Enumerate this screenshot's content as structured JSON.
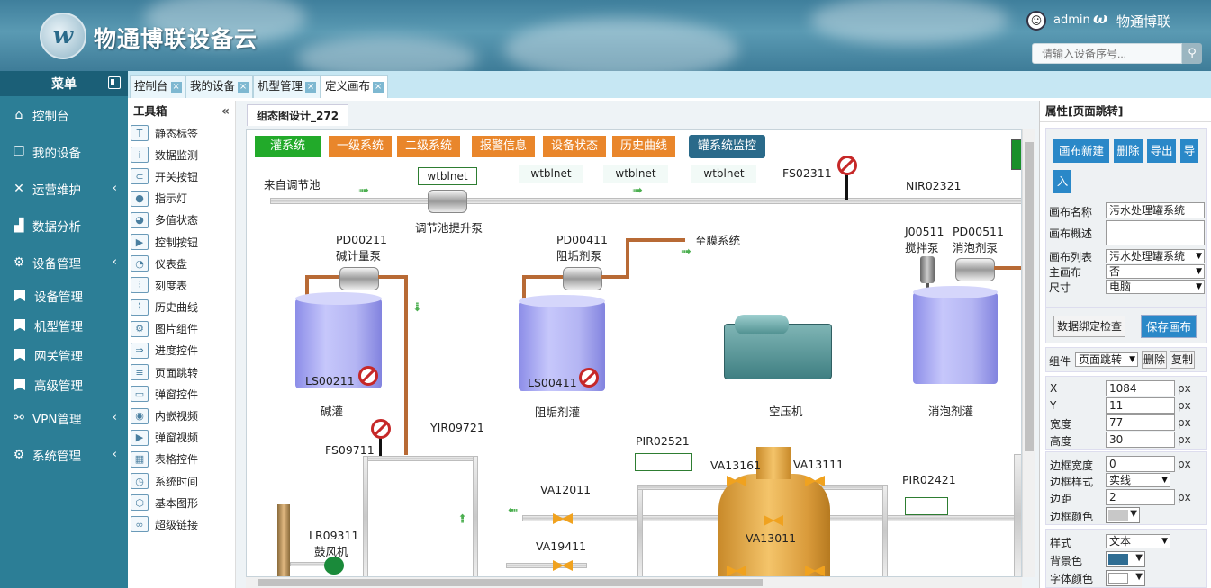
{
  "header": {
    "logo_mark": "w",
    "logo_text": "物通博联设备云",
    "user_avatar": "☺",
    "user_name": "admin",
    "brand_mark": "ω",
    "brand_name": "物通博联",
    "search_placeholder": "请输入设备序号...",
    "search_icon": "search-icon"
  },
  "sidebar": {
    "title": "菜单",
    "items": [
      {
        "icon": "⌂",
        "label": "控制台",
        "arrow": ""
      },
      {
        "icon": "❐",
        "label": "我的设备",
        "arrow": ""
      },
      {
        "icon": "✕",
        "label": "运营维护",
        "arrow": "‹"
      },
      {
        "icon": "▟",
        "label": "数据分析",
        "arrow": ""
      },
      {
        "icon": "⚙",
        "label": "设备管理",
        "arrow": "‹"
      }
    ],
    "subitems": [
      "设备管理",
      "机型管理",
      "网关管理",
      "高级管理"
    ],
    "items2": [
      {
        "icon": "⚯",
        "label": "VPN管理",
        "arrow": "‹"
      },
      {
        "icon": "⚙",
        "label": "系统管理",
        "arrow": "‹"
      }
    ]
  },
  "tabs": [
    {
      "label": "控制台"
    },
    {
      "label": "我的设备"
    },
    {
      "label": "机型管理"
    },
    {
      "label": "定义画布"
    }
  ],
  "toolbox": {
    "title": "工具箱",
    "collapse": "«",
    "items": [
      {
        "icon": "T",
        "label": "静态标签"
      },
      {
        "icon": "i",
        "label": "数据监测"
      },
      {
        "icon": "⊂",
        "label": "开关按钮"
      },
      {
        "icon": "●",
        "label": "指示灯"
      },
      {
        "icon": "◕",
        "label": "多值状态"
      },
      {
        "icon": "▶",
        "label": "控制按钮"
      },
      {
        "icon": "◔",
        "label": "仪表盘"
      },
      {
        "icon": "⫶",
        "label": "刻度表"
      },
      {
        "icon": "⌇",
        "label": "历史曲线"
      },
      {
        "icon": "⚙",
        "label": "图片组件"
      },
      {
        "icon": "⇒",
        "label": "进度控件"
      },
      {
        "icon": "≡",
        "label": "页面跳转"
      },
      {
        "icon": "▭",
        "label": "弹窗控件"
      },
      {
        "icon": "◉",
        "label": "内嵌视频"
      },
      {
        "icon": "▶",
        "label": "弹窗视频"
      },
      {
        "icon": "▦",
        "label": "表格控件"
      },
      {
        "icon": "◷",
        "label": "系统时间"
      },
      {
        "icon": "⬡",
        "label": "基本图形"
      },
      {
        "icon": "∞",
        "label": "超级链接"
      }
    ]
  },
  "canvas": {
    "design_tab": "组态图设计_272",
    "buttons": [
      "灌系统",
      "一级系统",
      "二级系统",
      "报警信息",
      "设备状态",
      "历史曲线",
      "罐系统监控"
    ],
    "labels": {
      "from_pool": "来自调节池",
      "pump_lift": "调节池提升泵",
      "fs02311": "FS02311",
      "nir02321": "NIR02321",
      "pd00211": "PD00211",
      "pump_alkali": "碱计量泵",
      "pd00411": "PD00411",
      "pump_scale": "阻垢剂泵",
      "to_membrane": "至膜系统",
      "j00511": "J00511",
      "mixer": "搅拌泵",
      "pd00511": "PD00511",
      "pump_defoam": "消泡剂泵",
      "ls00211": "LS00211",
      "ls00411": "LS00411",
      "tank_alkali": "碱灌",
      "tank_scale": "阻垢剂灌",
      "compressor": "空压机",
      "tank_defoam": "消泡剂灌",
      "yir09721": "YIR09721",
      "fs09711": "FS09711",
      "pir02521": "PIR02521",
      "va13161": "VA13161",
      "va13111": "VA13111",
      "pir02421": "PIR02421",
      "va12011": "VA12011",
      "va19411": "VA19411",
      "va13011": "VA13011",
      "lr09311": "LR09311",
      "blower": "鼓风机"
    },
    "values": [
      "wtblnet",
      "wtblnet",
      "wtblnet",
      "wtblnet"
    ]
  },
  "props": {
    "title": "属性[页面跳转]",
    "btn_new": "画布新建",
    "btn_delete": "删除",
    "btn_export": "导出",
    "btn_import_1": "导",
    "btn_import_2": "入",
    "name_label": "画布名称",
    "name_value": "污水处理罐系统",
    "desc_label": "画布概述",
    "list_label": "画布列表",
    "list_value": "污水处理罐系统",
    "main_label": "主画布",
    "main_value": "否",
    "size_label": "尺寸",
    "size_value": "电脑",
    "btn_check": "数据绑定检查",
    "btn_save": "保存画布",
    "comp_label": "组件",
    "comp_value": "页面跳转",
    "btn_comp_delete": "删除",
    "btn_copy": "复制",
    "x_label": "X",
    "x_value": "1084",
    "y_label": "Y",
    "y_value": "11",
    "w_label": "宽度",
    "w_value": "77",
    "h_label": "高度",
    "h_value": "30",
    "unit": "px",
    "bw_label": "边框宽度",
    "bw_value": "0",
    "bs_label": "边框样式",
    "bs_value": "实线",
    "pad_label": "边距",
    "pad_value": "2",
    "bc_label": "边框颜色",
    "style_label": "样式",
    "style_value": "文本",
    "bg_label": "背景色",
    "fc_label": "字体颜色"
  },
  "colors": {
    "header": "#3f7f9c",
    "sidebar": "#2c7e96",
    "green_btn": "#22aa2a",
    "orange_btn": "#e9862b",
    "blue_btn": "#2a6a8a",
    "accent": "#2a88c8",
    "tank": "#b4b5f3",
    "valve": "#f0a21f",
    "bg_swatch": "#2f6d93",
    "border_swatch": "#c8c8c8",
    "font_swatch": "#ffffff"
  }
}
